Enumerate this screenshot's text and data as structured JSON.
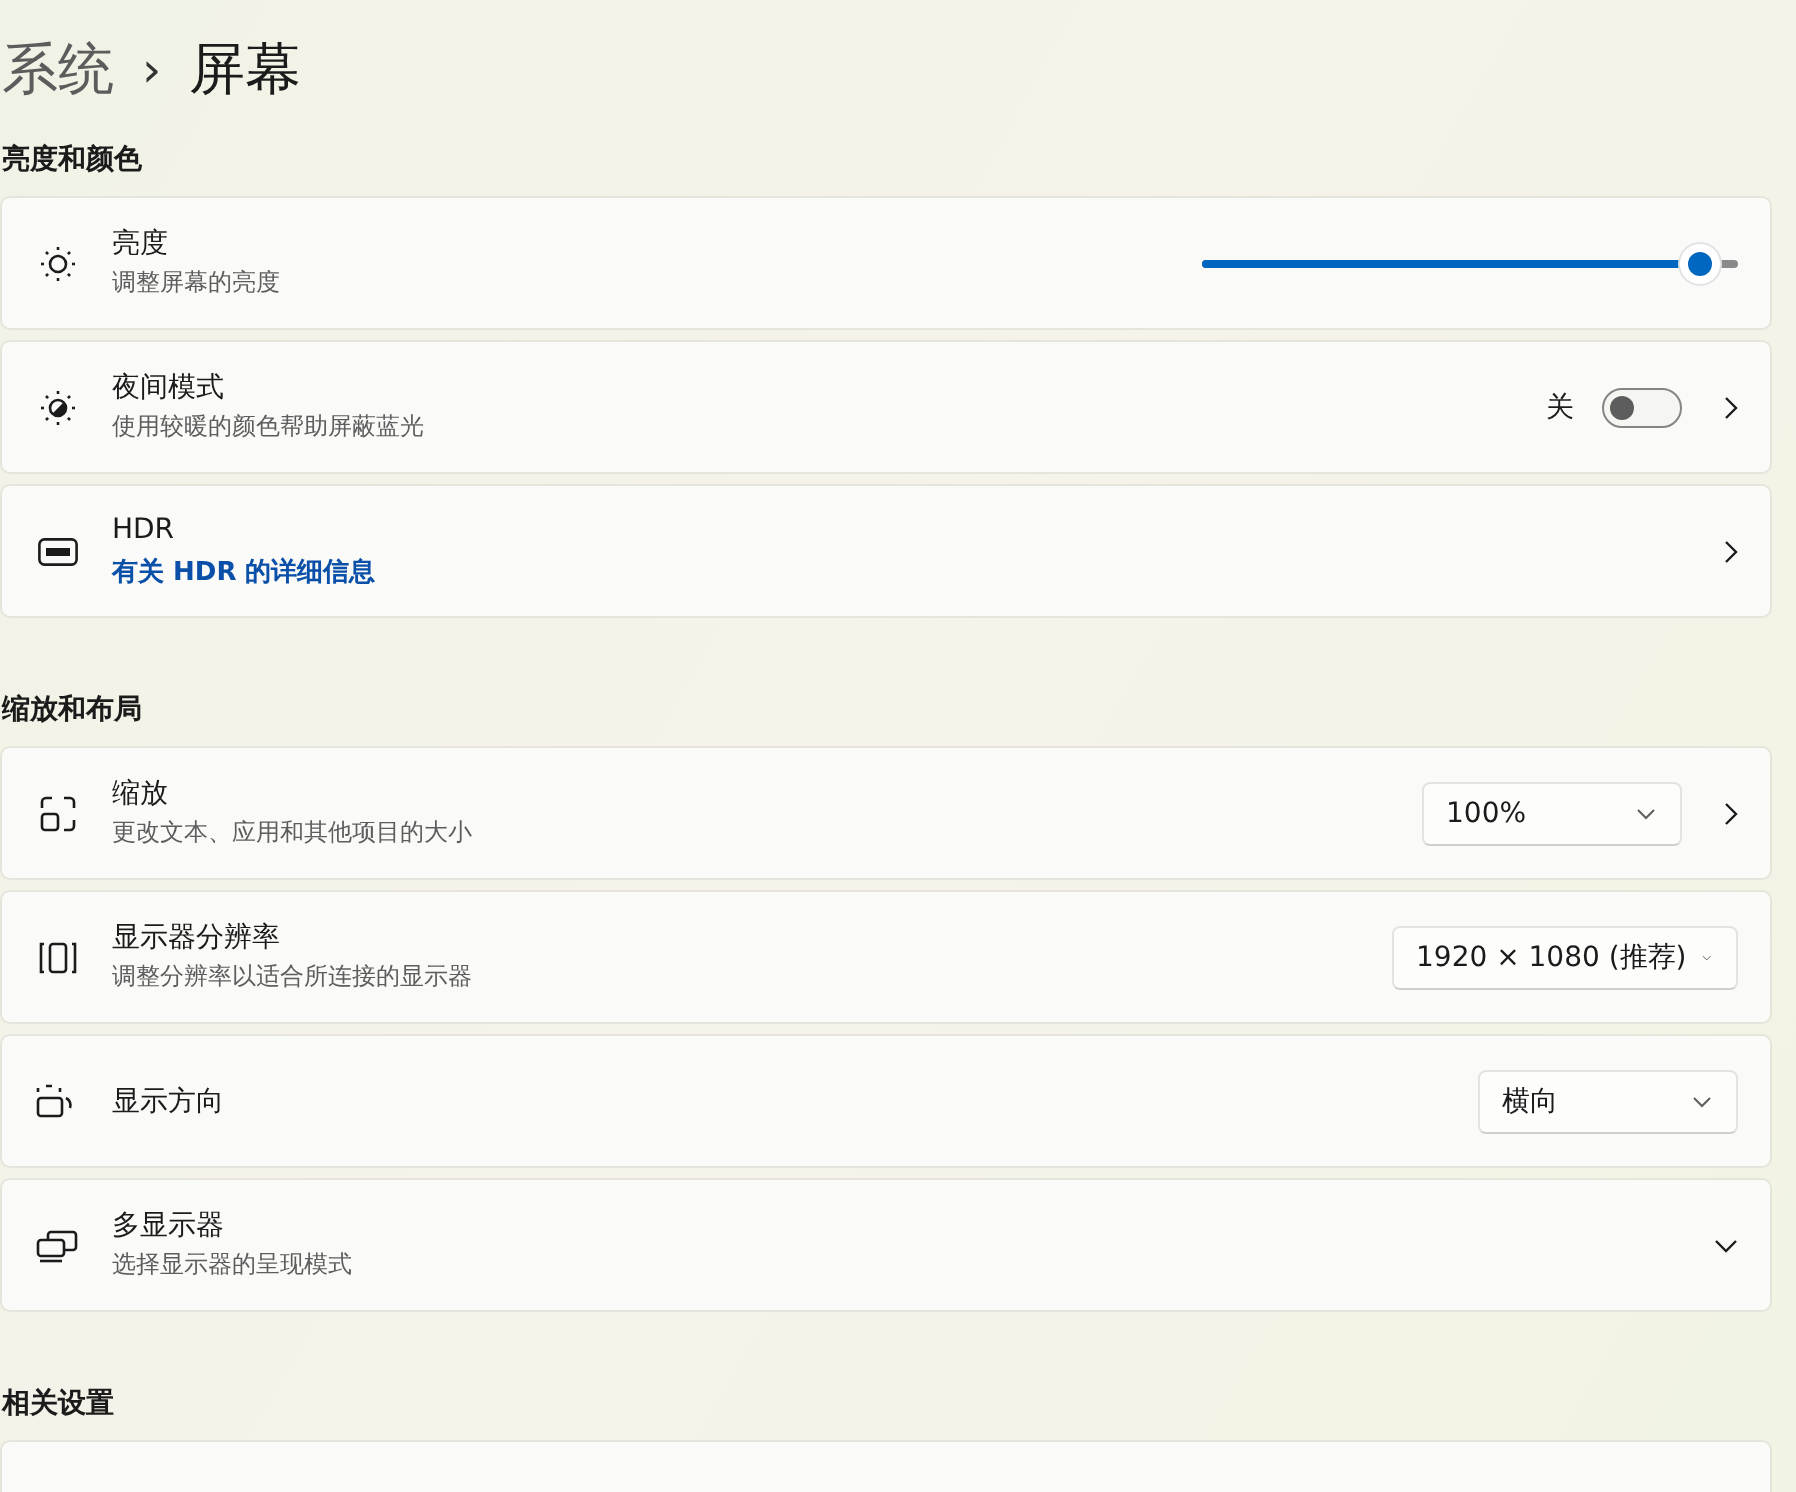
{
  "breadcrumb": {
    "parent": "系统",
    "separator": "›",
    "current": "屏幕"
  },
  "sections": [
    {
      "title": "亮度和颜色",
      "items": [
        {
          "title": "亮度",
          "subtitle": "调整屏幕的亮度",
          "kind": "slider",
          "level": 0.93
        },
        {
          "title": "夜间模式",
          "subtitle": "使用较暖的颜色帮助屏蔽蓝光",
          "kind": "toggle",
          "state_label": "关",
          "on": false
        },
        {
          "title": "HDR",
          "link": "有关 HDR 的详细信息",
          "kind": "link"
        }
      ]
    },
    {
      "title": "缩放和布局",
      "items": [
        {
          "title": "缩放",
          "subtitle": "更改文本、应用和其他项目的大小",
          "kind": "dropdown",
          "value": "100%"
        },
        {
          "title": "显示器分辨率",
          "subtitle": "调整分辨率以适合所连接的显示器",
          "kind": "dropdown",
          "value": "1920 × 1080 (推荐)"
        },
        {
          "title": "显示方向",
          "kind": "dropdown",
          "value": "横向"
        },
        {
          "title": "多显示器",
          "subtitle": "选择显示器的呈现模式",
          "kind": "expander"
        }
      ]
    },
    {
      "title": "相关设置",
      "items": [
        {
          "kind": "cut"
        }
      ]
    }
  ]
}
